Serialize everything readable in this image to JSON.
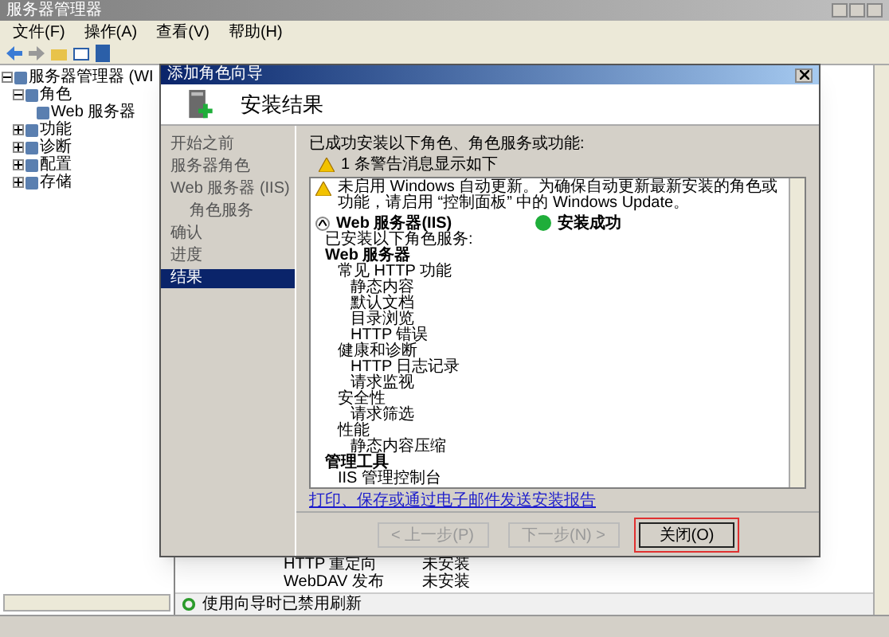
{
  "window": {
    "title": "服务器管理器"
  },
  "menu": [
    "文件(F)",
    "操作(A)",
    "查看(V)",
    "帮助(H)"
  ],
  "tree": [
    {
      "label": "服务器管理器 (WI",
      "expanded": true,
      "children": [
        {
          "label": "角色",
          "expanded": true,
          "children": [
            {
              "label": "Web 服务器"
            }
          ]
        },
        {
          "label": "功能",
          "expanded": false
        },
        {
          "label": "诊断",
          "expanded": false
        },
        {
          "label": "配置",
          "expanded": false
        },
        {
          "label": "存储",
          "expanded": false
        }
      ]
    }
  ],
  "role_services": [
    {
      "name": "HTTP 重定向",
      "status": "未安装"
    },
    {
      "name": "WebDAV 发布",
      "status": "未安装"
    }
  ],
  "refresh_notice": "使用向导时已禁用刷新",
  "dialog": {
    "title": "添加角色向导",
    "heading": "安装结果",
    "steps": [
      {
        "label": "开始之前",
        "selected": false
      },
      {
        "label": "服务器角色",
        "selected": false
      },
      {
        "label": "Web 服务器 (IIS)",
        "selected": false,
        "children": [
          {
            "label": "角色服务",
            "selected": false
          }
        ]
      },
      {
        "label": "确认",
        "selected": false
      },
      {
        "label": "进度",
        "selected": false
      },
      {
        "label": "结果",
        "selected": true
      }
    ],
    "intro": "已成功安装以下角色、角色服务或功能:",
    "warning_summary": "1 条警告消息显示如下",
    "results": {
      "warning": "未启用 Windows 自动更新。为确保自动更新最新安装的角色或功能，请启用 “控制面板” 中的 Windows Update。",
      "role": "Web 服务器(IIS)",
      "expanded": true,
      "status": "安装成功",
      "details": [
        {
          "label": "已安装以下角色服务:",
          "bold": false
        },
        {
          "label": "Web 服务器",
          "bold": true,
          "children": [
            {
              "label": "常见 HTTP 功能",
              "bold": false,
              "children": [
                {
                  "label": "静态内容",
                  "bold": false
                },
                {
                  "label": "默认文档",
                  "bold": false
                },
                {
                  "label": "目录浏览",
                  "bold": false
                },
                {
                  "label": "HTTP 错误",
                  "bold": false
                }
              ]
            },
            {
              "label": "健康和诊断",
              "bold": false,
              "children": [
                {
                  "label": "HTTP 日志记录",
                  "bold": false
                },
                {
                  "label": "请求监视",
                  "bold": false
                }
              ]
            },
            {
              "label": "安全性",
              "bold": false,
              "children": [
                {
                  "label": "请求筛选",
                  "bold": false
                }
              ]
            },
            {
              "label": "性能",
              "bold": false,
              "children": [
                {
                  "label": "静态内容压缩",
                  "bold": false
                }
              ]
            }
          ]
        },
        {
          "label": "管理工具",
          "bold": true,
          "children": [
            {
              "label": "IIS 管理控制台",
              "bold": false
            }
          ]
        }
      ]
    },
    "report_link": "打印、保存或通过电子邮件发送安装报告",
    "buttons": [
      {
        "label": "< 上一步(P)",
        "disabled": true,
        "highlighted": false
      },
      {
        "label": "下一步(N) >",
        "disabled": true,
        "highlighted": false
      },
      {
        "label": "关闭(O)",
        "disabled": false,
        "highlighted": true
      }
    ]
  }
}
